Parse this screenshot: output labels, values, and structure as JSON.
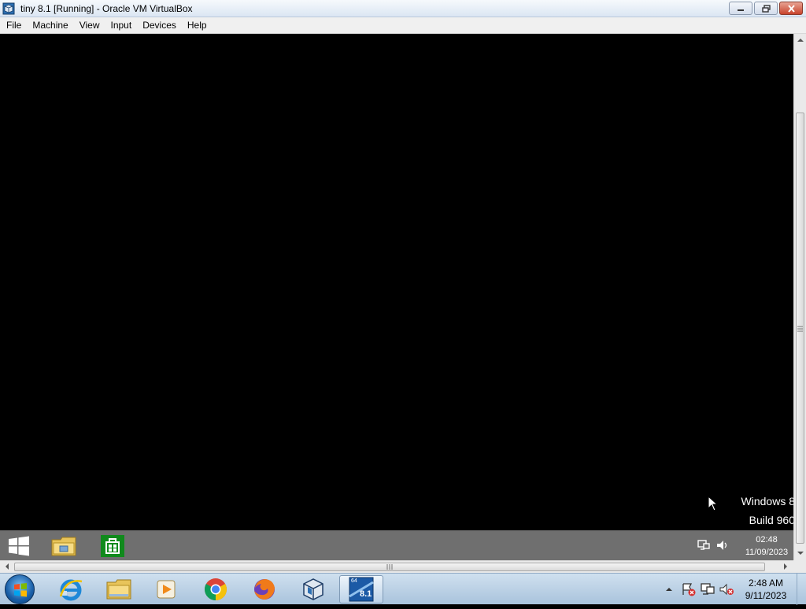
{
  "window": {
    "title": "tiny 8.1 [Running] - Oracle VM VirtualBox",
    "icon": "virtualbox-icon",
    "controls": [
      "minimize-icon",
      "restore-icon",
      "close-icon"
    ]
  },
  "menu": {
    "items": [
      "File",
      "Machine",
      "View",
      "Input",
      "Devices",
      "Help"
    ]
  },
  "vm_screen": {
    "watermark_line1": "Windows 8",
    "watermark_line2": "Build 960"
  },
  "guest_taskbar": {
    "pinned": [
      "windows-start-icon",
      "file-explorer-icon",
      "store-icon"
    ],
    "tray": [
      "network-icon",
      "volume-icon"
    ],
    "clock_time": "02:48",
    "clock_date": "11/09/2023"
  },
  "host_taskbar": {
    "pinned": [
      "internet-explorer-icon",
      "windows-explorer-icon",
      "media-player-icon",
      "chrome-icon",
      "firefox-icon",
      "virtualbox-icon",
      "tiny-81-vm-icon"
    ],
    "active": "tiny-81-vm-icon",
    "tray": [
      "show-hidden-icons-icon",
      "action-center-icon",
      "network-icon",
      "volume-muted-icon"
    ],
    "clock_time": "2:48 AM",
    "clock_date": "9/11/2023",
    "vm_badge_top": "64",
    "vm_badge_main": "8.1"
  },
  "colors": {
    "vm_background": "#000000",
    "guest_taskbar": "#6f6f6f",
    "host_taskbar": "#b9cfe4"
  }
}
